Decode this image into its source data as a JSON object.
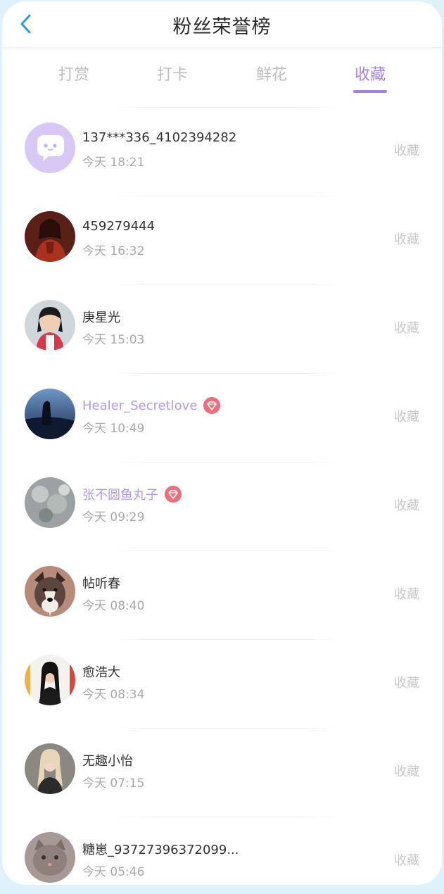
{
  "header": {
    "title": "粉丝荣誉榜",
    "back_icon": "chevron-left-icon",
    "accent": "#2f9be0"
  },
  "tabs": [
    {
      "label": "打赏",
      "active": false
    },
    {
      "label": "打卡",
      "active": false
    },
    {
      "label": "鲜花",
      "active": false
    },
    {
      "label": "收藏",
      "active": true
    }
  ],
  "colors": {
    "active_tab": "#a185dd",
    "vip_name": "#b39ae6",
    "badge": "#ee6f7c"
  },
  "fans": [
    {
      "name": "137***336_4102394282",
      "time": "今天 18:21",
      "action": "收藏",
      "vip": false,
      "avatar": "default-chat-avatar"
    },
    {
      "name": "459279444",
      "time": "今天 16:32",
      "action": "收藏",
      "vip": false,
      "avatar": "photo-red-dress"
    },
    {
      "name": "庚星光",
      "time": "今天 15:03",
      "action": "收藏",
      "vip": false,
      "avatar": "photo-girl"
    },
    {
      "name": "Healer_Secretlove",
      "time": "今天 10:49",
      "action": "收藏",
      "vip": true,
      "avatar": "photo-night-blue"
    },
    {
      "name": "张不圆鱼丸子",
      "time": "今天 09:29",
      "action": "收藏",
      "vip": true,
      "avatar": "photo-gray-flowers"
    },
    {
      "name": "帖听春",
      "time": "今天 08:40",
      "action": "收藏",
      "vip": false,
      "avatar": "photo-dog"
    },
    {
      "name": "愈浩大",
      "time": "今天 08:34",
      "action": "收藏",
      "vip": false,
      "avatar": "photo-woman-long-hair"
    },
    {
      "name": "无趣小怡",
      "time": "今天 07:15",
      "action": "收藏",
      "vip": false,
      "avatar": "photo-woman-blonde"
    },
    {
      "name": "糖崽_93727396372099...",
      "time": "今天 05:46",
      "action": "收藏",
      "vip": false,
      "avatar": "photo-cat"
    }
  ]
}
